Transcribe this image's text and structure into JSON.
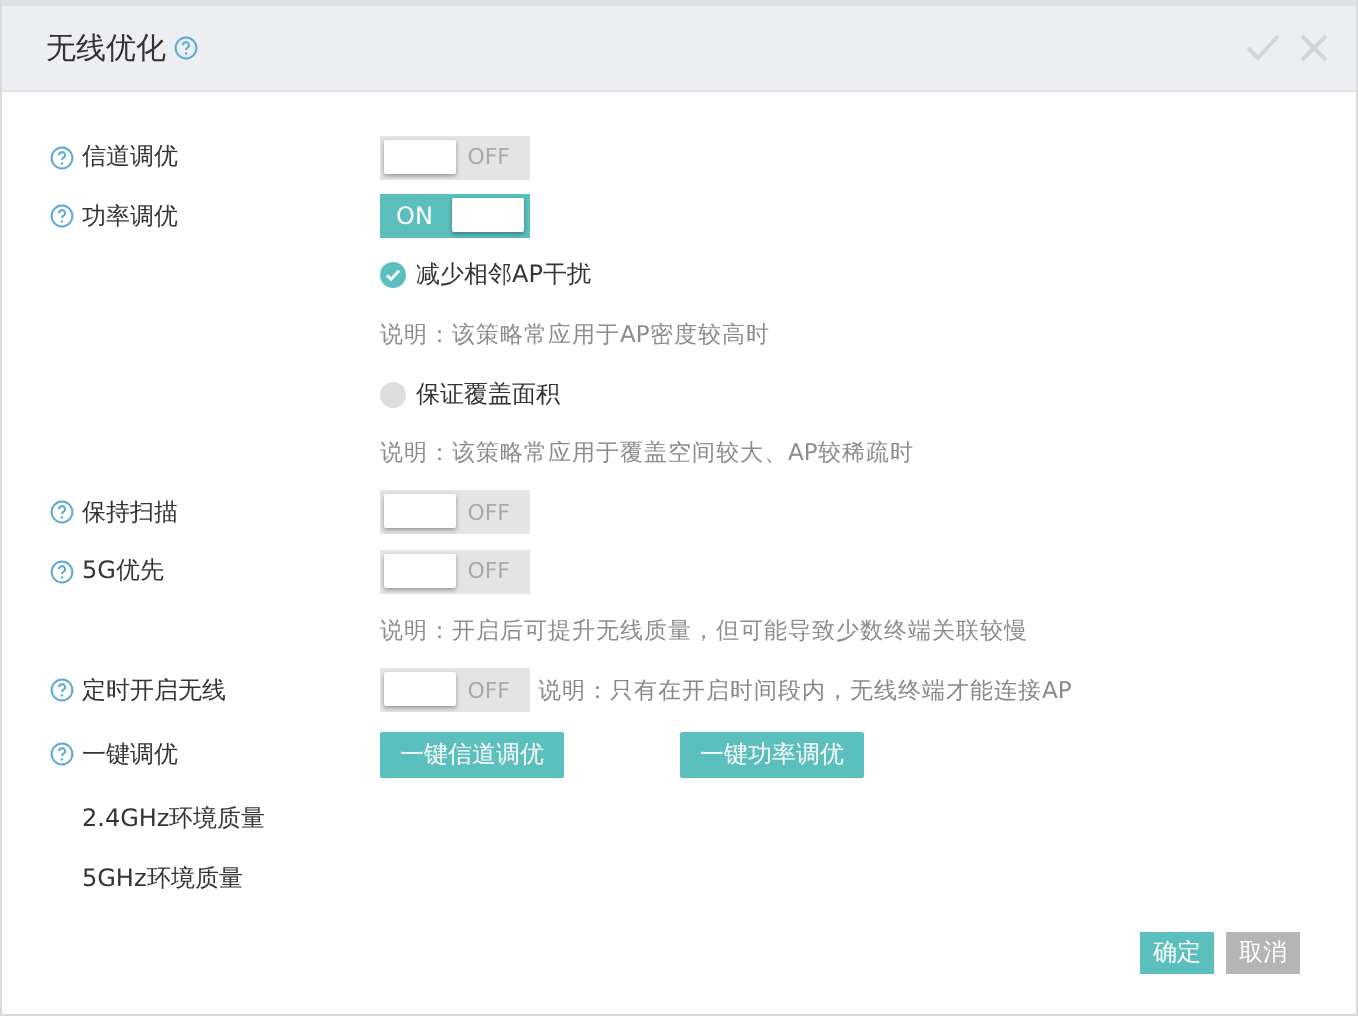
{
  "window": {
    "title": "无线优化",
    "help": true
  },
  "settings": [
    {
      "kind": "toggle",
      "label": "信道调优",
      "help": true,
      "on": false,
      "state_text": "OFF"
    },
    {
      "kind": "toggle",
      "label": "功率调优",
      "help": true,
      "on": true,
      "state_text": "ON"
    },
    {
      "kind": "radio",
      "label": "减少相邻AP干扰",
      "selected": true
    },
    {
      "kind": "note",
      "text": "说明：该策略常应用于AP密度较高时"
    },
    {
      "kind": "radio",
      "label": "保证覆盖面积",
      "selected": false
    },
    {
      "kind": "note",
      "text": "说明：该策略常应用于覆盖空间较大、AP较稀疏时"
    },
    {
      "kind": "toggle",
      "label": "保持扫描",
      "help": true,
      "on": false,
      "state_text": "OFF"
    },
    {
      "kind": "toggle",
      "label": "5G优先",
      "help": true,
      "on": false,
      "state_text": "OFF"
    },
    {
      "kind": "note",
      "text": "说明：开启后可提升无线质量，但可能导致少数终端关联较慢"
    },
    {
      "kind": "toggle",
      "label": "定时开启无线",
      "help": true,
      "on": false,
      "state_text": "OFF",
      "note": "说明：只有在开启时间段内，无线终端才能连接AP"
    },
    {
      "kind": "actions",
      "label": "一键调优",
      "help": true,
      "buttons": [
        "一键信道调优",
        "一键功率调优"
      ]
    },
    {
      "kind": "text",
      "label": "2.4GHz环境质量",
      "help": false
    },
    {
      "kind": "text",
      "label": "5GHz环境质量",
      "help": false
    }
  ],
  "footer": {
    "buttons": [
      {
        "label": "确定",
        "kind": "primary"
      },
      {
        "label": "取消",
        "kind": "secondary"
      }
    ]
  }
}
